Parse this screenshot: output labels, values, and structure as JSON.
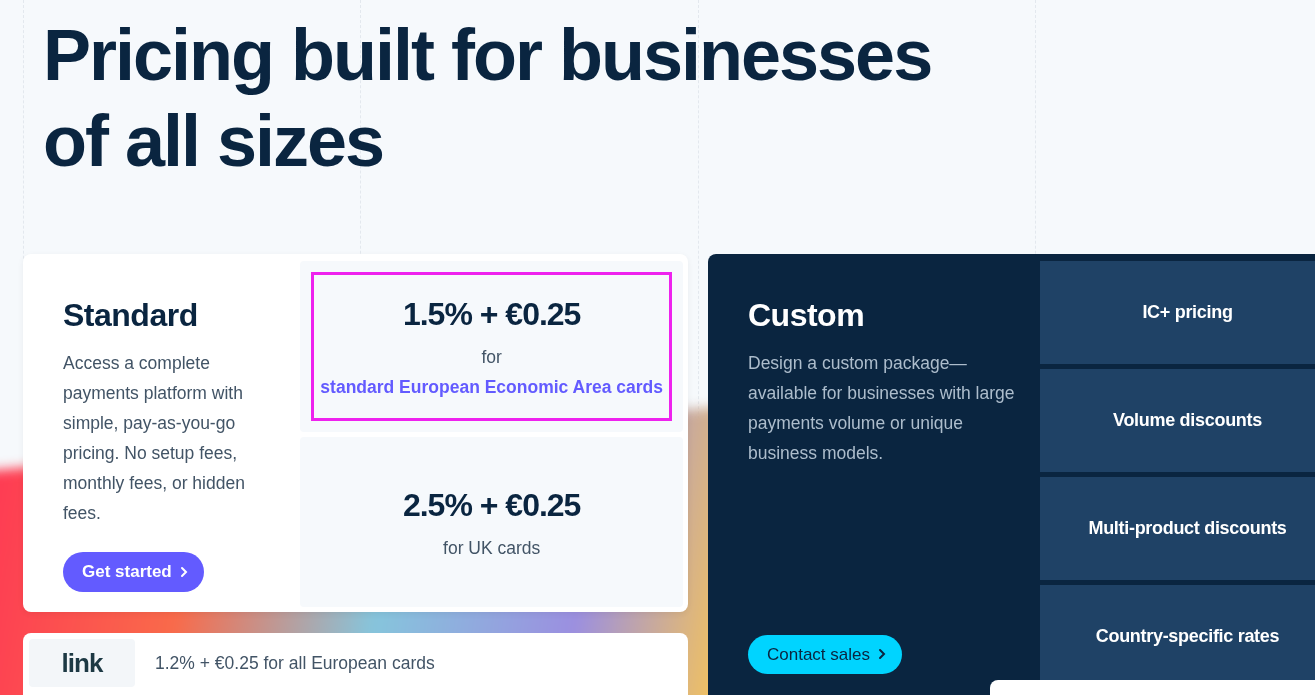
{
  "heading_lines": [
    "Pricing built for businesses",
    "of all sizes"
  ],
  "standard": {
    "title": "Standard",
    "description": "Access a complete payments platform with simple, pay-as-you-go pricing. No setup fees, monthly fees, or hidden fees.",
    "button": "Get started",
    "rates": [
      {
        "price": "1.5% + €0.25",
        "caption": "for",
        "link": "standard European Economic Area cards",
        "highlighted": true
      },
      {
        "price": "2.5% + €0.25",
        "caption": "for UK cards",
        "highlighted": false
      }
    ]
  },
  "link_offer": {
    "logo": "link",
    "text": "1.2% + €0.25 for all European cards"
  },
  "custom": {
    "title": "Custom",
    "description": "Design a custom package—available for businesses with large payments volume or unique business models.",
    "button": "Contact sales",
    "features": [
      "IC+ pricing",
      "Volume discounts",
      "Multi-product discounts",
      "Country-specific rates"
    ]
  }
}
